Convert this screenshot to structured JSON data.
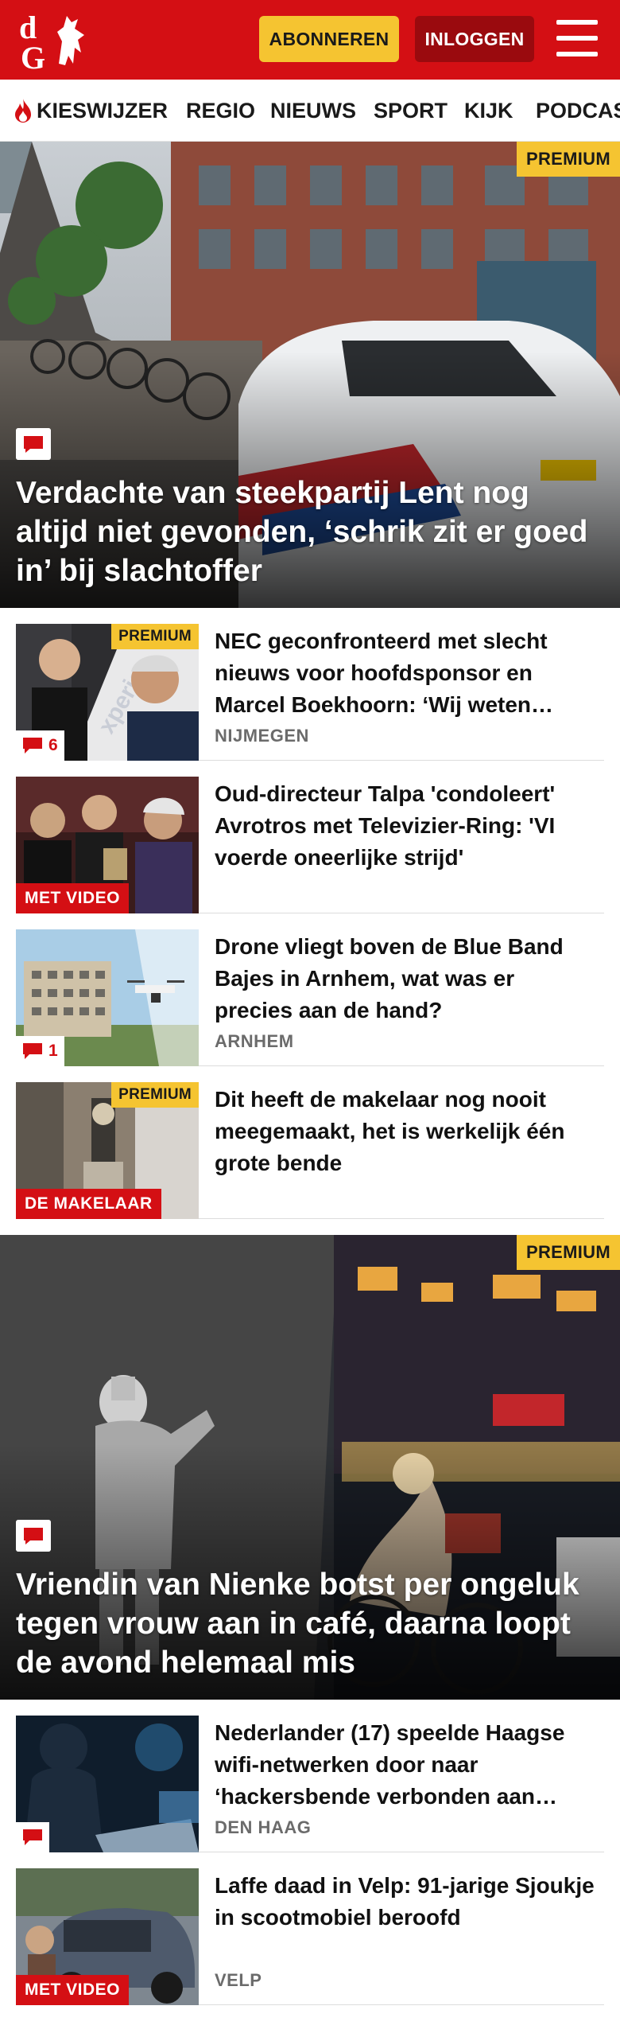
{
  "header": {
    "logo_text": "dG",
    "subscribe_label": "ABONNEREN",
    "login_label": "INLOGGEN",
    "menu_icon": "hamburger-menu-icon"
  },
  "nav": {
    "items": [
      "KIESWIJZER",
      "REGIO",
      "NIEUWS",
      "SPORT",
      "KIJK",
      "PODCAST"
    ]
  },
  "colors": {
    "brand_red": "#d40f14",
    "premium_yellow": "#f5c431",
    "login_dark_red": "#9a0a0e",
    "tag_gray": "#6b6b6b"
  },
  "hero1": {
    "badge": "PREMIUM",
    "title": "Verdachte van steekpartij Lent nog altijd niet gevonden, ‘schrik zit er goed in’ bij slachtoffer",
    "icon": "comment-icon"
  },
  "articles1": [
    {
      "title": "NEC geconfronteerd met slecht nieuws voor hoofdsponsor en Marcel Boekhoorn: ‘Wij weten…",
      "tag": "NIJMEGEN",
      "premium": "PREMIUM",
      "comments": "6"
    },
    {
      "title": "Oud-directeur Talpa 'condoleert' Avrotros met Televizier-Ring: 'VI voerde oneerlijke strijd'",
      "label": "MET VIDEO"
    },
    {
      "title": "Drone vliegt boven de Blue Band Bajes in Arnhem, wat was er precies aan de hand?",
      "tag": "ARNHEM",
      "comments": "1"
    },
    {
      "title": "Dit heeft de makelaar nog nooit meegemaakt, het is werkelijk één grote bende",
      "premium": "PREMIUM",
      "label": "DE MAKELAAR"
    }
  ],
  "hero2": {
    "badge": "PREMIUM",
    "title": "Vriendin van Nienke botst per ongeluk tegen vrouw aan in café, daarna loopt de avond helemaal mis",
    "icon": "comment-icon"
  },
  "articles2": [
    {
      "title": "Nederlander (17) speelde Haagse wifi-netwerken door naar ‘hackersbende verbonden aan…",
      "tag": "DEN HAAG"
    },
    {
      "title": "Laffe daad in Velp: 91-jarige Sjoukje in scootmobiel beroofd",
      "tag": "VELP",
      "label": "MET VIDEO"
    }
  ]
}
